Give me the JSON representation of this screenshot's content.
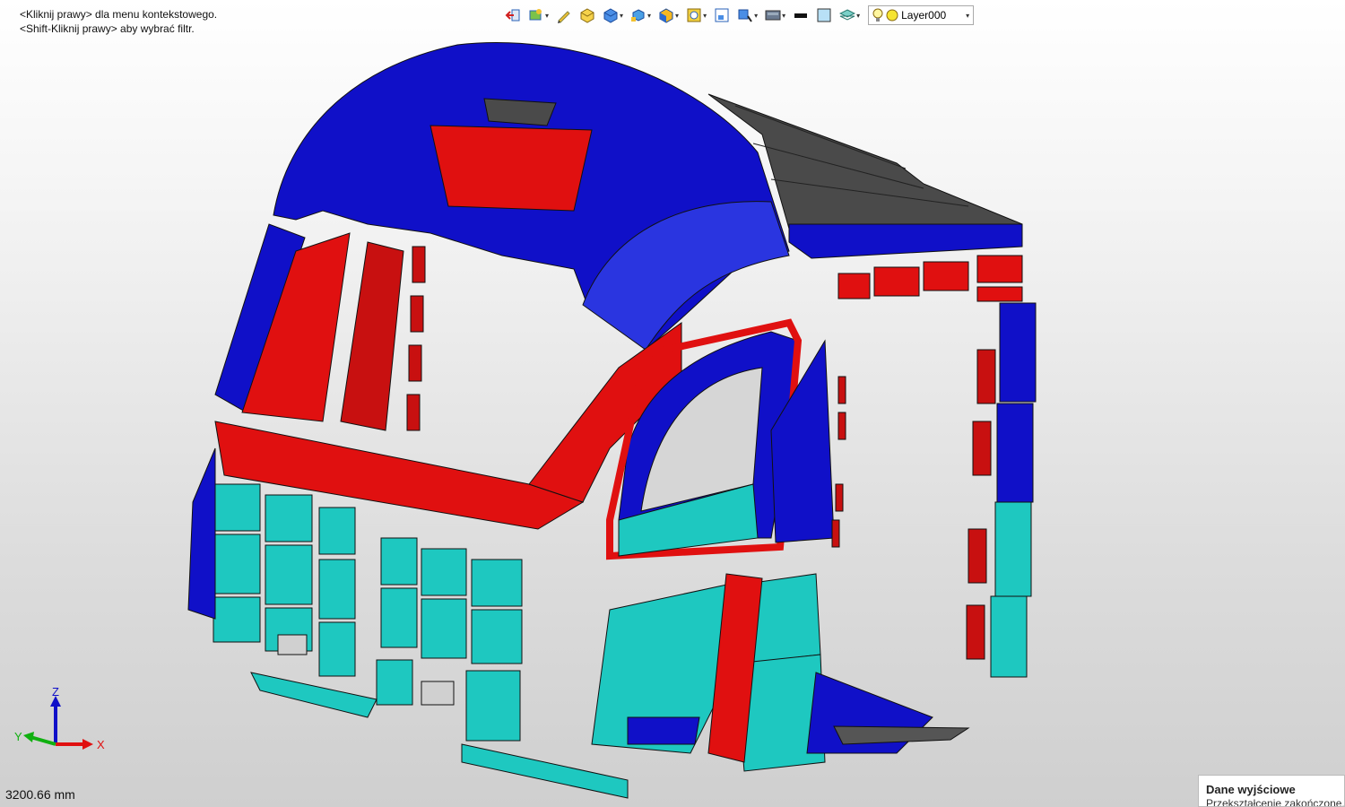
{
  "hints": {
    "line1": "<Kliknij prawy> dla menu kontekstowego.",
    "line2": "<Shift-Kliknij prawy> aby wybrać filtr."
  },
  "toolbar": {
    "tools": [
      {
        "icon": "exit-arrow-icon",
        "has_dropdown": false
      },
      {
        "icon": "shaded-view-icon",
        "has_dropdown": true
      },
      {
        "icon": "edit-pencil-icon",
        "has_dropdown": false
      },
      {
        "icon": "yellow-cube-icon",
        "has_dropdown": false
      },
      {
        "icon": "blue-cube-icon",
        "has_dropdown": true
      },
      {
        "icon": "cube-views-icon",
        "has_dropdown": true
      },
      {
        "icon": "cube-section-icon",
        "has_dropdown": true
      },
      {
        "icon": "zoom-fit-icon",
        "has_dropdown": true
      },
      {
        "icon": "zoom-window-icon",
        "has_dropdown": false
      },
      {
        "icon": "view-orient-icon",
        "has_dropdown": true
      },
      {
        "icon": "display-mode-icon",
        "has_dropdown": true
      },
      {
        "icon": "line-color-icon",
        "has_dropdown": false
      },
      {
        "icon": "fill-color-icon",
        "has_dropdown": false
      },
      {
        "icon": "layers-icon",
        "has_dropdown": true
      }
    ],
    "layer": "Layer000"
  },
  "axis": {
    "z": "Z",
    "y": "Y",
    "x": "X"
  },
  "status": {
    "measurement": "3200.66 mm"
  },
  "output_panel": {
    "title": "Dane wyjściowe",
    "message": "Przekształcenie zakończone."
  },
  "colors": {
    "blue": "#1010c8",
    "red": "#e01010",
    "cyan": "#1ec8c0",
    "dark_gray": "#4a4a4a"
  }
}
